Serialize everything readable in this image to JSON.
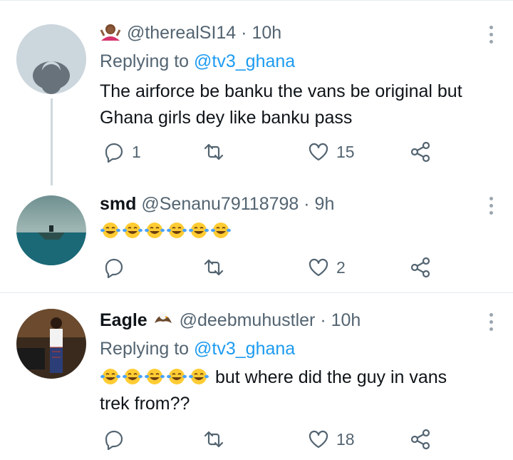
{
  "tweets": [
    {
      "handle": "@therealSI14",
      "separator": "·",
      "time": "10h",
      "replying_prefix": "Replying to",
      "replying_handle": "@tv3_ghana",
      "text": "The airforce be banku the vans be original but Ghana girls dey like banku pass",
      "replies": "1",
      "likes": "15"
    },
    {
      "name": "smd",
      "handle": "@Senanu79118798",
      "separator": "·",
      "time": "9h",
      "emoji_count": 6,
      "likes": "2"
    },
    {
      "name": "Eagle",
      "handle": "@deebmuhustler",
      "separator": "·",
      "time": "10h",
      "replying_prefix": "Replying to",
      "replying_handle": "@tv3_ghana",
      "text_line1": "but where did the guy in vans",
      "text_line2": "trek from??",
      "likes": "18"
    }
  ],
  "icons": {
    "reply": "reply-icon",
    "retweet": "retweet-icon",
    "like": "heart-icon",
    "share": "share-icon",
    "more": "more-options-icon",
    "laughing": "face-with-tears-of-joy-emoji"
  },
  "colors": {
    "link": "#1d9bf0",
    "muted": "#536471",
    "divider": "#e6ecf0",
    "thread_line": "#cfd9de"
  }
}
